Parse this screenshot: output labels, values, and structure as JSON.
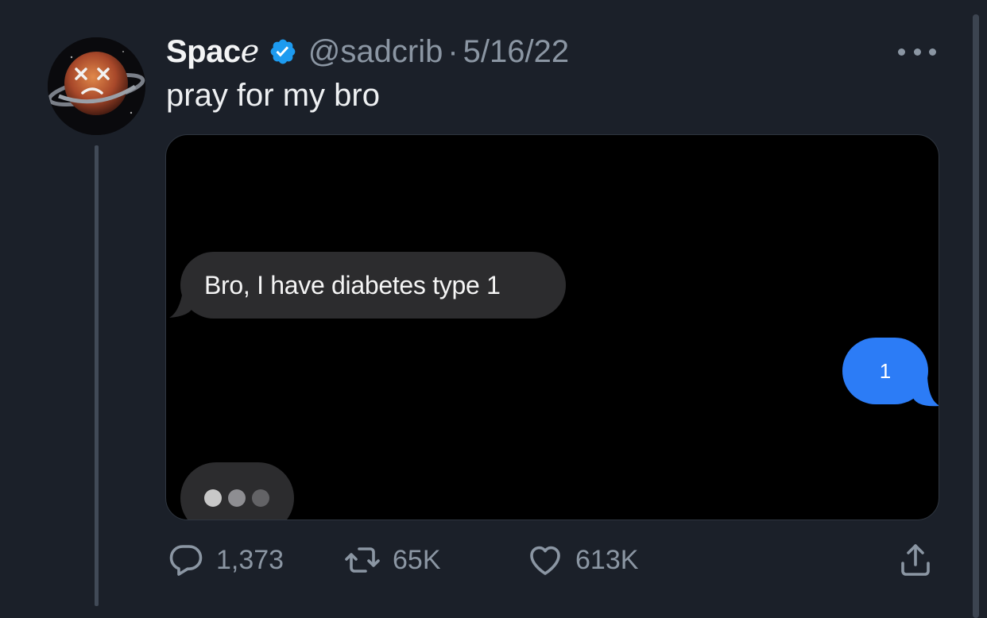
{
  "tweet": {
    "display_name_main": "Spac",
    "display_name_tail": "e",
    "verified": true,
    "handle": "@sadcrib",
    "separator": "·",
    "date": "5/16/22",
    "text": "pray for my bro",
    "more_icon": "ellipsis-icon"
  },
  "media": {
    "received_message": "Bro, I have diabetes type 1",
    "sent_message": "1",
    "typing_indicator": "typing-dots"
  },
  "actions": {
    "reply_count": "1,373",
    "retweet_count": "65K",
    "like_count": "613K",
    "share_icon": "share-icon"
  },
  "colors": {
    "background": "#1b2029",
    "verified_badge": "#1d9bf0",
    "sent_bubble": "#2c7cf6",
    "received_bubble": "#2c2c2e",
    "muted_text": "#8b96a3"
  }
}
